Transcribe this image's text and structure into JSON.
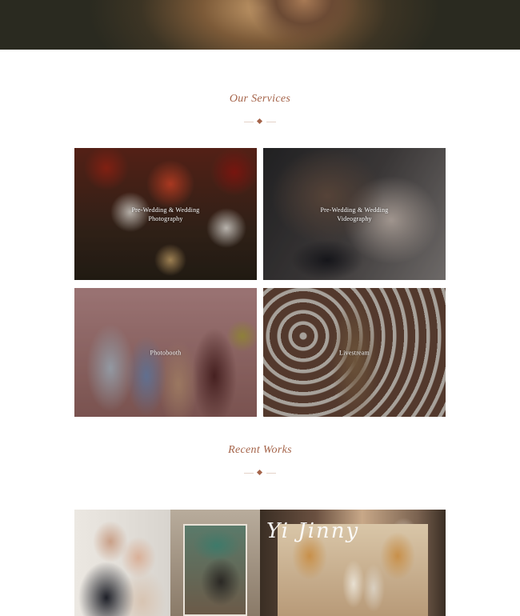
{
  "services": {
    "title": "Our Services",
    "tiles": [
      {
        "label": "Pre-Wedding & Wedding\nPhotography"
      },
      {
        "label": "Pre-Wedding & Wedding\nVideography"
      },
      {
        "label": "Photobooth"
      },
      {
        "label": "Livestream"
      }
    ]
  },
  "recent_works": {
    "title": "Recent Works",
    "featured_script": "Yi Jinny"
  },
  "colors": {
    "accent": "#a5644a",
    "divider": "#e4d3c8"
  }
}
